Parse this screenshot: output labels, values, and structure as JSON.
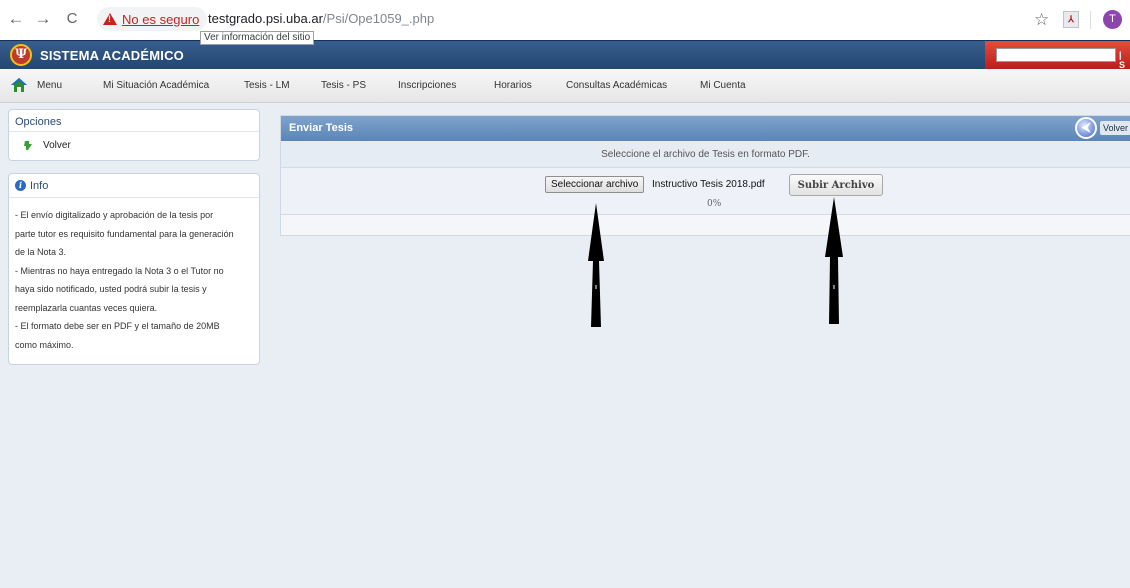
{
  "browser": {
    "back_icon": "←",
    "forward_icon": "→",
    "reload_icon": "C",
    "security_warning": "No es seguro",
    "url_host": "testgrado.psi.uba.ar",
    "url_path": "/Psi/Ope1059_.php",
    "tooltip": "Ver información del sitio",
    "profile_initial": "T"
  },
  "header": {
    "logo_glyph": "Ψ",
    "title": "SISTEMA ACADÉMICO",
    "right_text": "| S"
  },
  "menu": {
    "items": [
      "Menu",
      "Mi Situación Académica",
      "Tesis - LM",
      "Tesis - PS",
      "Inscripciones",
      "Horarios",
      "Consultas Académicas",
      "Mi Cuenta"
    ]
  },
  "sidebar": {
    "options_title": "Opciones",
    "volver_label": "Volver",
    "info_title": "Info",
    "info_lines": [
      "- El envío digitalizado y aprobación de la tesis por",
      "parte tutor es requisito fundamental para la generación",
      "de la Nota 3.",
      "- Mientras no haya entregado la Nota 3 o el Tutor no",
      "haya sido notificado, usted podrá subir la tesis y",
      "reemplazarla cuantas veces quiera.",
      "- El formato debe ser en PDF y el tamaño de 20MB",
      "como máximo."
    ]
  },
  "main": {
    "title": "Enviar Tesis",
    "volver_label": "Volver",
    "instruction": "Seleccione el archivo de Tesis en formato PDF.",
    "select_file_button": "Seleccionar archivo",
    "file_name": "Instructivo Tesis  2018.pdf",
    "submit_button": "Subir Archivo",
    "progress": "0%"
  },
  "colors": {
    "header_blue": "#234672",
    "panel_blue": "#5b85b7",
    "warning_red": "#c5221f"
  }
}
